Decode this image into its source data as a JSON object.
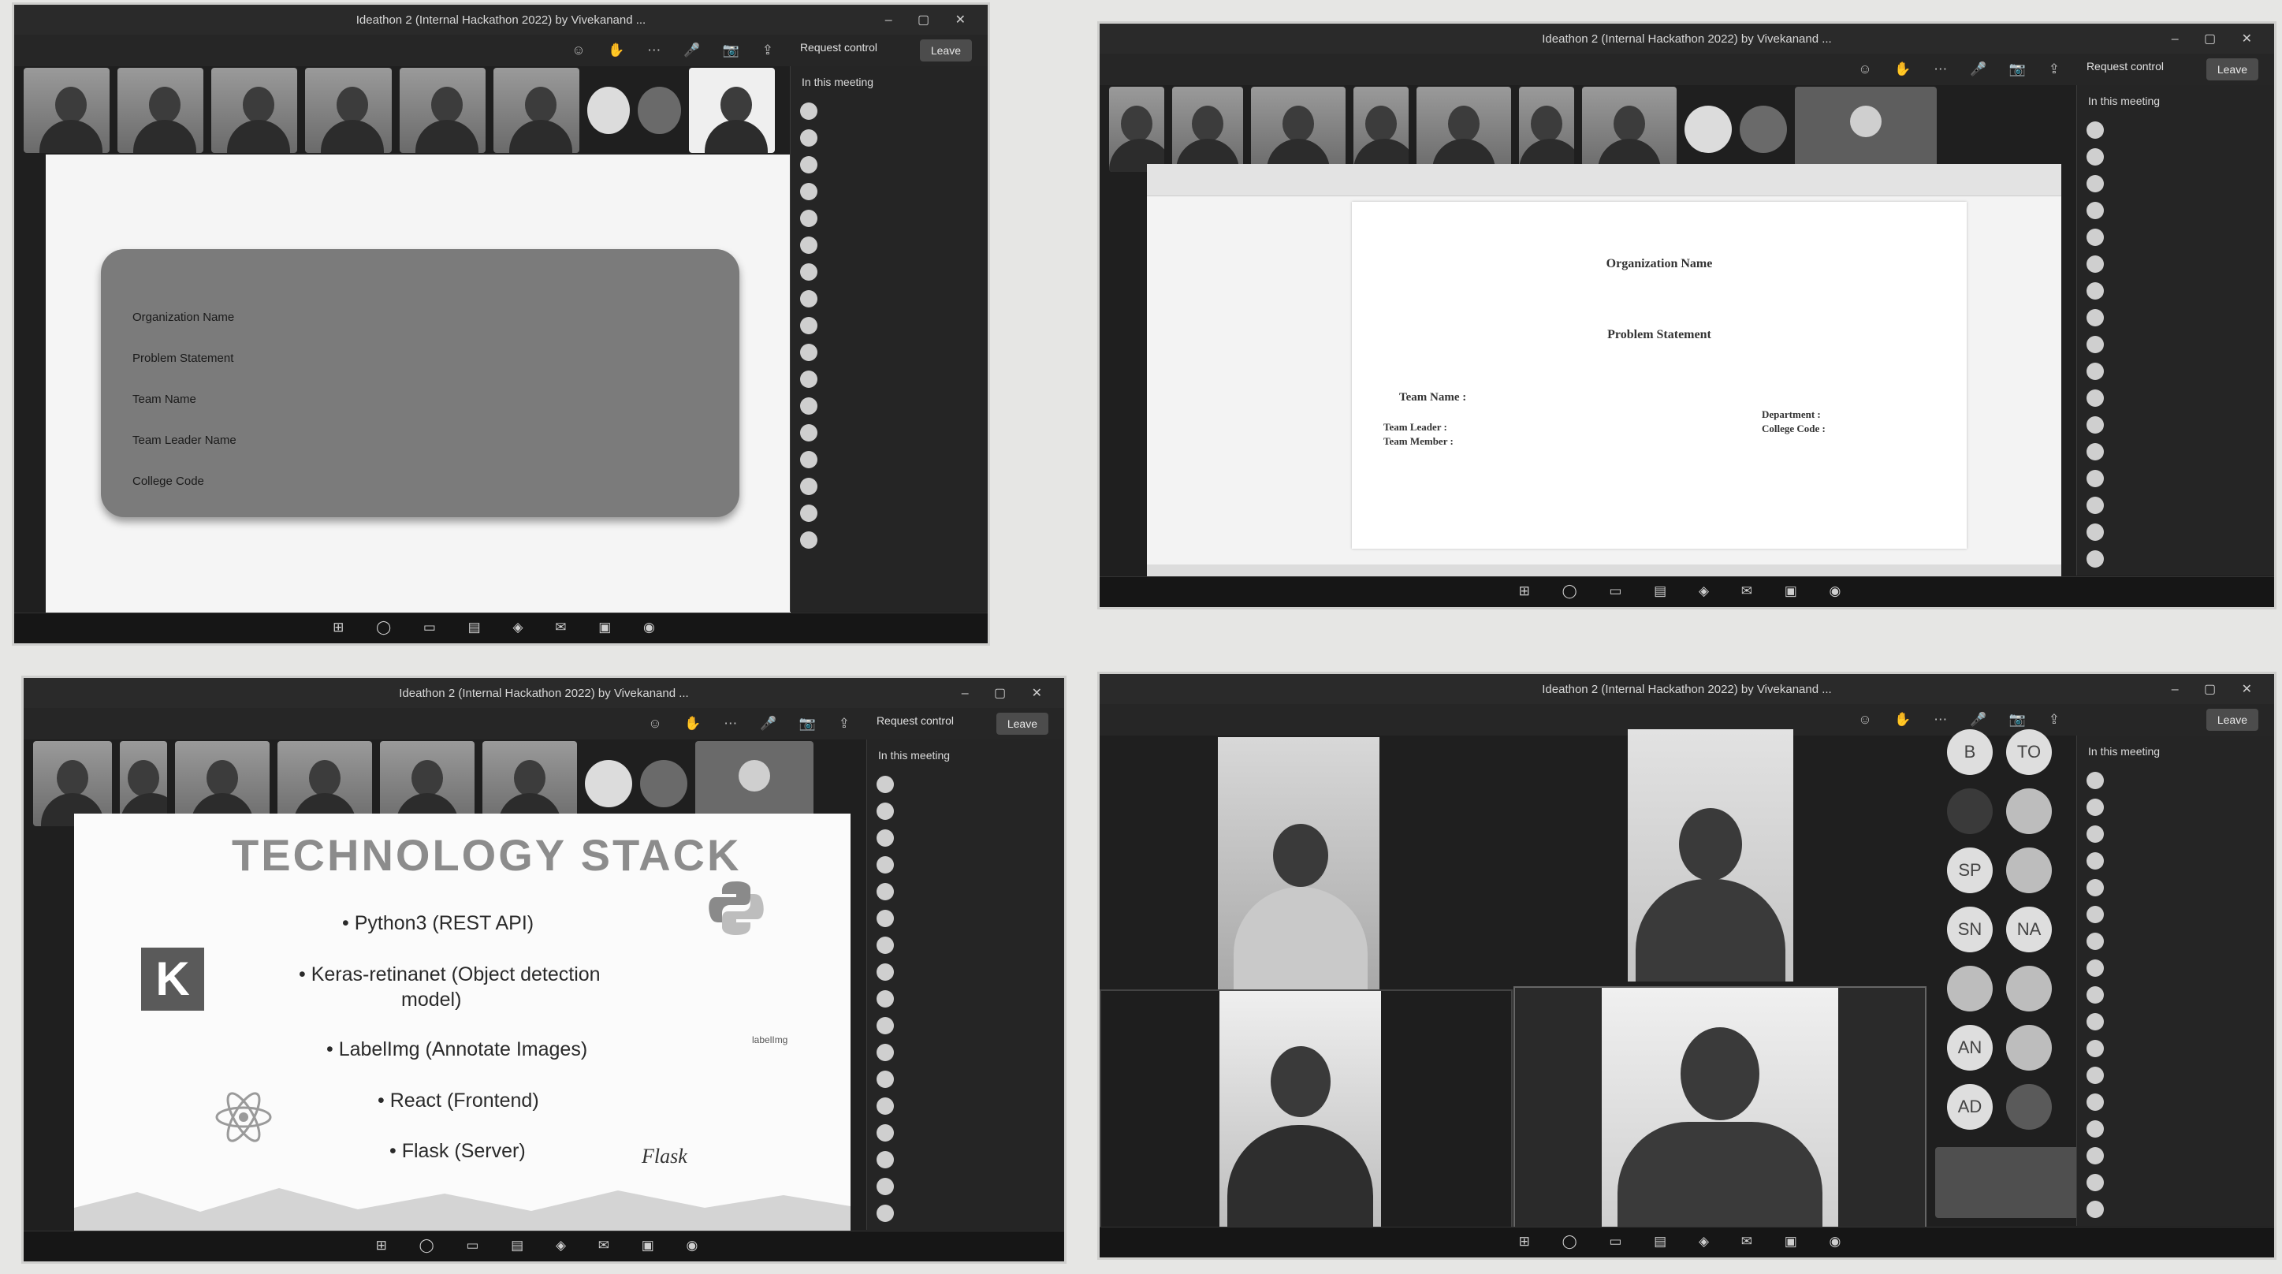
{
  "screens": {
    "s1": {
      "title": "Ideathon 2 (Internal Hackathon 2022) by Vivekanand ...",
      "sidebar_header": "In this meeting",
      "leave_label": "Leave",
      "request_label": "Request control",
      "form": {
        "labels": [
          "Organization Name",
          "Problem Statement",
          "Team Name",
          "Team Leader Name",
          "College Code"
        ],
        "values": [
          "",
          "",
          "",
          "",
          ""
        ]
      }
    },
    "s2": {
      "title": "Ideathon 2 (Internal Hackathon 2022) by Vivekanand ...",
      "sidebar_header": "In this meeting",
      "leave_label": "Leave",
      "request_label": "Request control",
      "doc": {
        "org_heading": "Organization Name",
        "problem_heading": "Problem Statement",
        "team_name_label": "Team Name : ",
        "team_leader_label": "Team Leader :",
        "team_member_label": "Team Member :",
        "department_label": "Department :",
        "college_code_label": "College Code :"
      }
    },
    "s3": {
      "title": "Ideathon 2 (Internal Hackathon 2022) by Vivekanand ...",
      "sidebar_header": "In this meeting",
      "leave_label": "Leave",
      "request_label": "Request control",
      "slide": {
        "title": "TECHNOLOGY STACK",
        "bullets": [
          "• Python3 (REST API)",
          "• Keras-retinanet (Object detection",
          "model)",
          "• LabelImg (Annotate Images)",
          "• React (Frontend)",
          "• Flask (Server)"
        ],
        "k_logo": "K",
        "flask_logo": "Flask",
        "labelimg_logo": "labelImg"
      }
    },
    "s4": {
      "title": "Ideathon 2 (Internal Hackathon 2022) by Vivekanand ...",
      "sidebar_header": "In this meeting",
      "leave_label": "Leave",
      "avatars": [
        "B",
        "TO",
        "SP",
        "SN",
        "NA",
        "AN",
        "AD"
      ]
    }
  }
}
